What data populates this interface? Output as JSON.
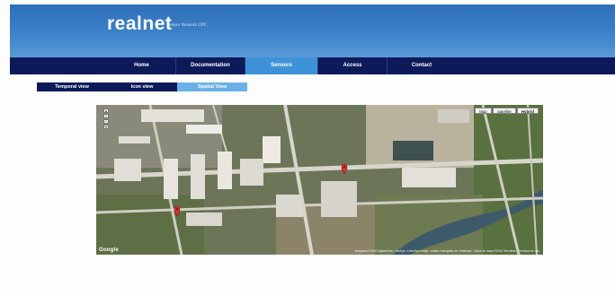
{
  "header": {
    "logo": "realnet",
    "tagline": "Sensor Network UPC"
  },
  "nav": {
    "items": [
      {
        "label": "Home"
      },
      {
        "label": "Documentation"
      },
      {
        "label": "Sensors"
      },
      {
        "label": "Access"
      },
      {
        "label": "Contact"
      }
    ],
    "active": "Sensors"
  },
  "subnav": {
    "items": [
      {
        "label": "Temporal view"
      },
      {
        "label": "Icon view"
      },
      {
        "label": "Spatial View"
      }
    ],
    "active": "Spatial View"
  },
  "map": {
    "types": [
      {
        "label": "Map"
      },
      {
        "label": "Satellite"
      },
      {
        "label": "Hybrid"
      }
    ],
    "active_type": "Hybrid",
    "google_logo": "Google",
    "copyright": "Imágenes ©2010 DigitalGlobe, GeoEye, Cnes/Spot Image, Institut Cartogràfic de Catalunya - Datos de mapa ©2010 Tele Atlas - Términos de uso",
    "marker_color": "#d8332c"
  }
}
